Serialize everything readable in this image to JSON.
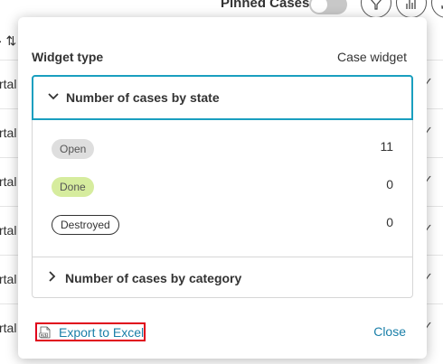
{
  "background": {
    "pinned_label": "Pinned Cases",
    "header_left": "· ⇅",
    "header_right": "s",
    "row_text": "rtal",
    "row_check": "✓"
  },
  "dialog": {
    "widget_type_label": "Widget type",
    "widget_type_value": "Case widget",
    "panels": [
      {
        "title": "Number of cases by state",
        "expanded": true,
        "states": [
          {
            "label": "Open",
            "count": "11",
            "color": "#dedede"
          },
          {
            "label": "Done",
            "count": "0",
            "color": "#d6ec9e"
          },
          {
            "label": "Destroyed",
            "count": "0",
            "color": "#ffffff"
          }
        ]
      },
      {
        "title": "Number of cases by category",
        "expanded": false
      }
    ],
    "export_label": "Export to Excel",
    "close_label": "Close"
  },
  "colors": {
    "accent": "#1a9fbf",
    "link": "#1a7fa8",
    "export_highlight": "#e0001b"
  }
}
